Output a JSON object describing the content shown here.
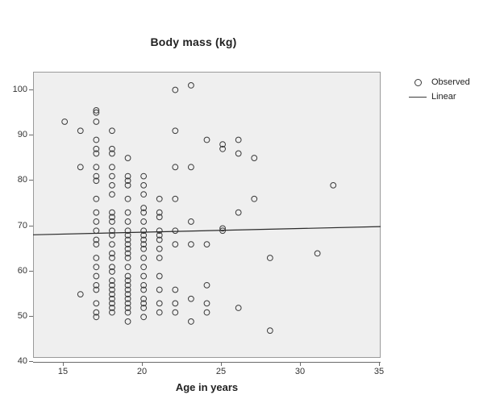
{
  "chart_data": {
    "type": "scatter",
    "title": "Body mass (kg)",
    "xlabel": "Age in years",
    "ylabel": "",
    "xlim": [
      14,
      36
    ],
    "ylim": [
      40,
      103
    ],
    "xticks": [
      15,
      20,
      25,
      30,
      35
    ],
    "yticks": [
      40,
      50,
      60,
      70,
      80,
      90,
      100
    ],
    "grid": false,
    "legend_position": "right",
    "legend": [
      {
        "label": "Observed",
        "symbol": "open-circle"
      },
      {
        "label": "Linear",
        "symbol": "line"
      }
    ],
    "series": [
      {
        "name": "Observed",
        "marker": "open-circle",
        "points": [
          [
            16,
            92
          ],
          [
            17,
            90
          ],
          [
            17,
            82
          ],
          [
            17,
            54
          ],
          [
            18,
            94.5
          ],
          [
            18,
            94
          ],
          [
            18,
            92
          ],
          [
            18,
            88
          ],
          [
            18,
            86
          ],
          [
            18,
            85
          ],
          [
            18,
            82
          ],
          [
            18,
            80
          ],
          [
            18,
            79
          ],
          [
            18,
            75
          ],
          [
            18,
            72
          ],
          [
            18,
            70
          ],
          [
            18,
            68
          ],
          [
            18,
            66
          ],
          [
            18,
            65
          ],
          [
            18,
            62
          ],
          [
            18,
            60
          ],
          [
            18,
            58
          ],
          [
            18,
            56
          ],
          [
            18,
            55
          ],
          [
            18,
            52
          ],
          [
            18,
            50
          ],
          [
            18,
            49
          ],
          [
            19,
            90
          ],
          [
            19,
            86
          ],
          [
            19,
            85
          ],
          [
            19,
            82
          ],
          [
            19,
            80
          ],
          [
            19,
            78
          ],
          [
            19,
            76
          ],
          [
            19,
            72
          ],
          [
            19,
            71
          ],
          [
            19,
            70
          ],
          [
            19,
            68
          ],
          [
            19,
            67
          ],
          [
            19,
            65
          ],
          [
            19,
            63
          ],
          [
            19,
            62
          ],
          [
            19,
            60
          ],
          [
            19,
            59
          ],
          [
            19,
            57
          ],
          [
            19,
            56
          ],
          [
            19,
            55
          ],
          [
            19,
            54
          ],
          [
            19,
            53
          ],
          [
            19,
            52
          ],
          [
            19,
            51
          ],
          [
            19,
            50
          ],
          [
            20,
            84
          ],
          [
            20,
            80
          ],
          [
            20,
            79
          ],
          [
            20,
            78
          ],
          [
            20,
            75
          ],
          [
            20,
            72
          ],
          [
            20,
            70
          ],
          [
            20,
            68
          ],
          [
            20,
            67
          ],
          [
            20,
            66
          ],
          [
            20,
            65
          ],
          [
            20,
            64
          ],
          [
            20,
            63
          ],
          [
            20,
            62
          ],
          [
            20,
            60
          ],
          [
            20,
            58
          ],
          [
            20,
            57
          ],
          [
            20,
            56
          ],
          [
            20,
            55
          ],
          [
            20,
            54
          ],
          [
            20,
            53
          ],
          [
            20,
            52
          ],
          [
            20,
            51
          ],
          [
            20,
            50
          ],
          [
            20,
            48
          ],
          [
            21,
            80
          ],
          [
            21,
            78
          ],
          [
            21,
            76
          ],
          [
            21,
            73
          ],
          [
            21,
            72
          ],
          [
            21,
            70
          ],
          [
            21,
            68
          ],
          [
            21,
            67
          ],
          [
            21,
            66
          ],
          [
            21,
            65
          ],
          [
            21,
            64
          ],
          [
            21,
            62
          ],
          [
            21,
            60
          ],
          [
            21,
            58
          ],
          [
            21,
            56
          ],
          [
            21,
            55
          ],
          [
            21,
            53
          ],
          [
            21,
            52
          ],
          [
            21,
            51
          ],
          [
            21,
            49
          ],
          [
            22,
            75
          ],
          [
            22,
            72
          ],
          [
            22,
            71
          ],
          [
            22,
            68
          ],
          [
            22,
            67
          ],
          [
            22,
            66
          ],
          [
            22,
            64
          ],
          [
            22,
            62
          ],
          [
            22,
            58
          ],
          [
            22,
            55
          ],
          [
            22,
            52
          ],
          [
            22,
            50
          ],
          [
            23,
            90
          ],
          [
            23,
            99
          ],
          [
            23,
            82
          ],
          [
            23,
            75
          ],
          [
            23,
            68
          ],
          [
            23,
            65
          ],
          [
            23,
            55
          ],
          [
            23,
            52
          ],
          [
            23,
            50
          ],
          [
            24,
            100
          ],
          [
            24,
            82
          ],
          [
            24,
            70
          ],
          [
            24,
            65
          ],
          [
            24,
            53
          ],
          [
            24,
            48
          ],
          [
            25,
            88
          ],
          [
            25,
            65
          ],
          [
            25,
            56
          ],
          [
            25,
            52
          ],
          [
            25,
            50
          ],
          [
            26,
            87
          ],
          [
            26,
            86
          ],
          [
            26,
            68.5
          ],
          [
            26,
            68
          ],
          [
            27,
            88
          ],
          [
            27,
            85
          ],
          [
            27,
            72
          ],
          [
            27,
            51
          ],
          [
            28,
            84
          ],
          [
            28,
            75
          ],
          [
            29,
            62
          ],
          [
            29,
            46
          ],
          [
            32,
            63
          ],
          [
            33,
            78
          ]
        ]
      },
      {
        "name": "Linear",
        "type": "line",
        "points": [
          [
            14,
            67.1
          ],
          [
            36,
            68.9
          ]
        ]
      }
    ]
  },
  "axis": {
    "y_tick_labels": [
      "100",
      "90",
      "80",
      "70",
      "60",
      "50",
      "40"
    ],
    "x_tick_labels": [
      "15",
      "20",
      "25",
      "30",
      "35"
    ]
  }
}
